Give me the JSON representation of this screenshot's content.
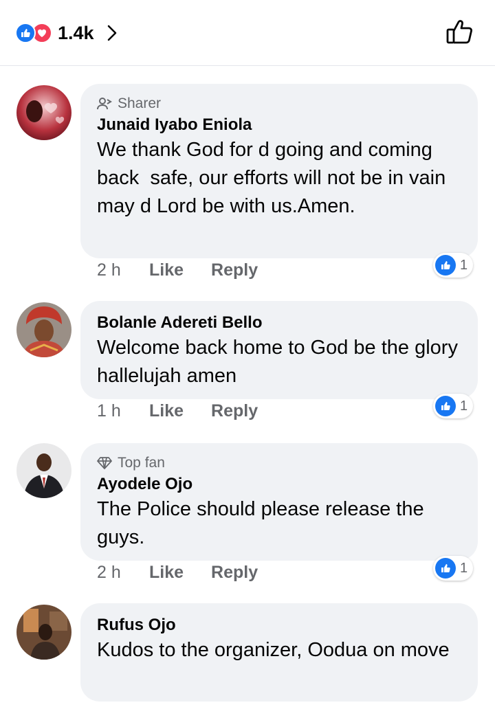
{
  "header": {
    "reaction_icons": [
      "like-icon",
      "love-icon"
    ],
    "reaction_count": "1.4k",
    "like_icon": "thumbs-up-outline-icon"
  },
  "comments": [
    {
      "badge_icon": "sharer-icon",
      "badge": "Sharer",
      "author": "Junaid Iyabo Eniola",
      "text": "We thank God for d going and coming back  safe, our efforts will not be in vain may d Lord be with us.Amen.",
      "time": "2 h",
      "like_label": "Like",
      "reply_label": "Reply",
      "reaction_count": "1"
    },
    {
      "author": "Bolanle Adereti Bello",
      "text": "Welcome back home to God be the glory hallelujah amen",
      "time": "1 h",
      "like_label": "Like",
      "reply_label": "Reply",
      "reaction_count": "1"
    },
    {
      "badge_icon": "diamond-icon",
      "badge": "Top fan",
      "author": "Ayodele Ojo",
      "text": "The Police should please release the guys.",
      "time": "2 h",
      "like_label": "Like",
      "reply_label": "Reply",
      "reaction_count": "1"
    },
    {
      "author": "Rufus Ojo",
      "text": "Kudos to the organizer, Oodua on move"
    }
  ],
  "colors": {
    "accent": "#1877f2",
    "love": "#f33e58",
    "bubble": "#f0f2f5",
    "secondary_text": "#65676b"
  }
}
